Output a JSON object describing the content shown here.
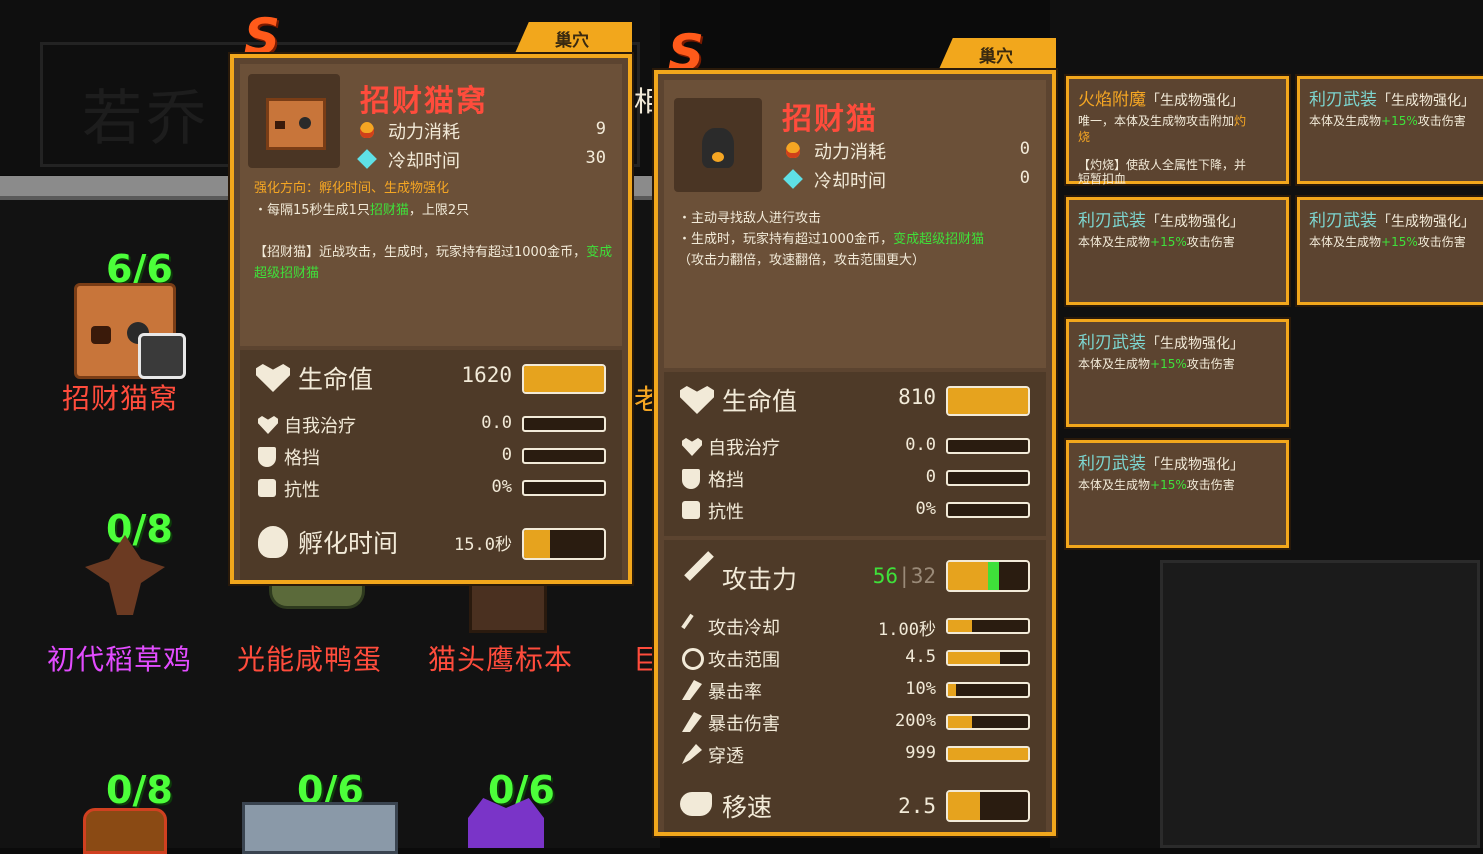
{
  "background": {
    "dark_title": "若乔",
    "grid": [
      {
        "count": "6/6",
        "name": "招财猫窝",
        "name_color": "#ff4c3c"
      },
      {
        "count": "0/8",
        "name": "初代稻草鸡",
        "name_color": "#e24cff"
      },
      {
        "count": "",
        "name": "光能咸鸭蛋",
        "name_color": "#ff4c3c"
      },
      {
        "count": "",
        "name": "猫头鹰标本",
        "name_color": "#ff4c3c"
      },
      {
        "count": "0/8",
        "name": "",
        "name_color": "#ff4c3c"
      },
      {
        "count": "0/6",
        "name": "",
        "name_color": "#ff4c3c"
      },
      {
        "count": "0/6",
        "name": "",
        "name_color": "#ff4c3c"
      }
    ],
    "partial_name_1": "巨",
    "partial_char_2": "老",
    "partial_char_3": "相"
  },
  "card1": {
    "rank": "S",
    "tab": "巢穴",
    "title": "招财猫窝",
    "power_label": "动力消耗",
    "power_value": "9",
    "cooldown_label": "冷却时间",
    "cooldown_value": "30",
    "upgrade_line": "强化方向：孵化时间、生成物强化",
    "desc_line1_a": "・每隔15秒生成1只",
    "desc_line1_b": "招财猫",
    "desc_line1_c": "，上限2只",
    "desc_line2": "【招财猫】近战攻击，生成时，玩家持有超过1000金币，",
    "desc_line3_b": "变成超级招财猫",
    "hp_label": "生命值",
    "hp_value": "1620",
    "hp_fill": 1.0,
    "heal_label": "自我治疗",
    "heal_value": "0.0",
    "block_label": "格挡",
    "block_value": "0",
    "resist_label": "抗性",
    "resist_value": "0%",
    "hatch_label": "孵化时间",
    "hatch_value": "15.0秒",
    "hatch_fill": 0.33
  },
  "card2": {
    "rank": "S",
    "tab": "巢穴",
    "title": "招财猫",
    "power_label": "动力消耗",
    "power_value": "0",
    "cooldown_label": "冷却时间",
    "cooldown_value": "0",
    "desc_line1": "・主动寻找敌人进行攻击",
    "desc_line2_a": "・生成时，玩家持有超过1000金币，",
    "desc_line2_b": "变成超级招财猫",
    "desc_line3": "（攻击力翻倍，攻速翻倍，攻击范围更大）",
    "hp_label": "生命值",
    "hp_value": "810",
    "hp_fill": 1.0,
    "heal_label": "自我治疗",
    "heal_value": "0.0",
    "block_label": "格挡",
    "block_value": "0",
    "resist_label": "抗性",
    "resist_value": "0%",
    "atk_label": "攻击力",
    "atk_value_a": "56",
    "atk_sep": "|",
    "atk_value_b": "32",
    "atk_fill": 0.5,
    "atk_fill_green": 0.14,
    "atkcd_label": "攻击冷却",
    "atkcd_value": "1.00秒",
    "atkcd_fill": 0.3,
    "range_label": "攻击范围",
    "range_value": "4.5",
    "range_fill": 0.65,
    "crit_label": "暴击率",
    "crit_value": "10%",
    "crit_fill": 0.1,
    "critdmg_label": "暴击伤害",
    "critdmg_value": "200%",
    "critdmg_fill": 0.3,
    "pierce_label": "穿透",
    "pierce_value": "999",
    "pierce_fill": 1.0,
    "speed_label": "移速",
    "speed_value": "2.5",
    "speed_fill": 0.4
  },
  "right_cards": [
    {
      "title": "火焰附魔",
      "tag": "「生成物强化」",
      "fire": true,
      "line1_a": "唯一，本体及生成物攻击附加",
      "line1_b": "灼",
      "line2_b": "烧",
      "line3": "【灼烧】使敌人全属性下降，并",
      "line4": "短暂扣血"
    },
    {
      "title": "利刃武装",
      "tag": "「生成物强化」",
      "fire": false,
      "line_a": "本体及生成物",
      "line_b": "+15%",
      "line_c": "攻击伤害"
    },
    {
      "title": "利刃武装",
      "tag": "「生成物强化」",
      "fire": false,
      "line_a": "本体及生成物",
      "line_b": "+15%",
      "line_c": "攻击伤害"
    },
    {
      "title": "利刃武装",
      "tag": "「生成物强化」",
      "fire": false,
      "line_a": "本体及生成物",
      "line_b": "+15%",
      "line_c": "攻击伤害"
    },
    {
      "title": "利刃武装",
      "tag": "「生成物强化」",
      "fire": false,
      "line_a": "本体及生成物",
      "line_b": "+15%",
      "line_c": "攻击伤害"
    },
    {
      "title": "利刃武装",
      "tag": "「生成物强化」",
      "fire": false,
      "line_a": "本体及生成物",
      "line_b": "+15%",
      "line_c": "攻击伤害"
    }
  ]
}
